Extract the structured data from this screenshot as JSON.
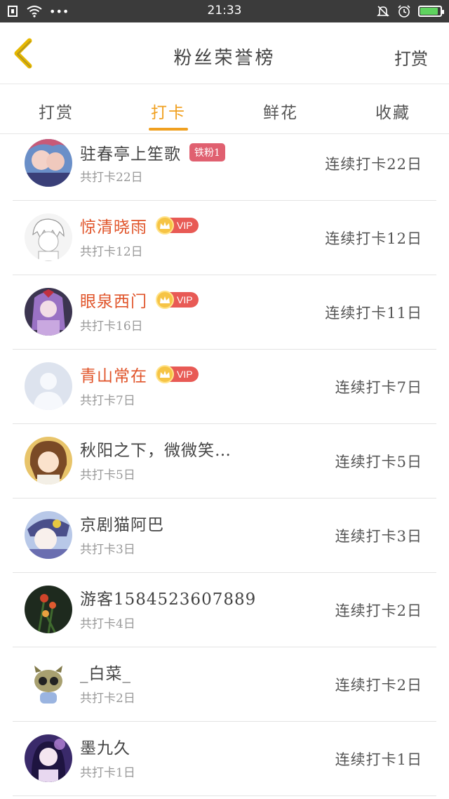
{
  "status_bar": {
    "time": "21:33",
    "dots": "•••"
  },
  "header": {
    "title": "粉丝荣誉榜",
    "action": "打赏"
  },
  "tabs": [
    {
      "label": "打赏",
      "active": false
    },
    {
      "label": "打卡",
      "active": true
    },
    {
      "label": "鲜花",
      "active": false
    },
    {
      "label": "收藏",
      "active": false
    }
  ],
  "rows": [
    {
      "name": "驻春亭上笙歌",
      "badge": "铁粉1",
      "sub": "共打卡22日",
      "right": "连续打卡22日"
    },
    {
      "name": "惊清晓雨",
      "badge": "VIP",
      "sub": "共打卡12日",
      "right": "连续打卡12日"
    },
    {
      "name": "眼泉西门",
      "badge": "VIP",
      "sub": "共打卡16日",
      "right": "连续打卡11日"
    },
    {
      "name": "青山常在",
      "badge": "VIP",
      "sub": "共打卡7日",
      "right": "连续打卡7日"
    },
    {
      "name": "秋阳之下，微微笑…",
      "badge": "",
      "sub": "共打卡5日",
      "right": "连续打卡5日"
    },
    {
      "name": "京剧猫阿巴",
      "badge": "",
      "sub": "共打卡3日",
      "right": "连续打卡3日"
    },
    {
      "name": "游客1584523607889",
      "badge": "",
      "sub": "共打卡4日",
      "right": "连续打卡2日"
    },
    {
      "name": "_白菜_",
      "badge": "",
      "sub": "共打卡2日",
      "right": "连续打卡2日"
    },
    {
      "name": "墨九久",
      "badge": "",
      "sub": "共打卡1日",
      "right": "连续打卡1日"
    }
  ],
  "colors": {
    "accent": "#f0a020",
    "vip_name": "#e0542a",
    "fan_badge": "#e06070"
  }
}
